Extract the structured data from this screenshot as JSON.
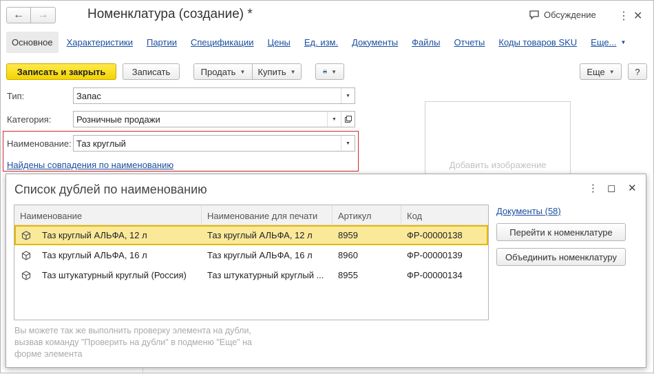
{
  "window": {
    "title": "Номенклатура (создание) *",
    "discussion": "Обсуждение"
  },
  "tabs": [
    "Основное",
    "Характеристики",
    "Партии",
    "Спецификации",
    "Цены",
    "Ед. изм.",
    "Документы",
    "Файлы",
    "Отчеты",
    "Коды товаров SKU",
    "Еще..."
  ],
  "toolbar": {
    "save_close": "Записать и закрыть",
    "save": "Записать",
    "sell": "Продать",
    "buy": "Купить",
    "more": "Еще",
    "help": "?"
  },
  "form": {
    "type_label": "Тип:",
    "type_value": "Запас",
    "category_label": "Категория:",
    "category_value": "Розничные продажи",
    "name_label": "Наименование:",
    "name_value": "Таз круглый",
    "matches_link": "Найдены совпадения по наименованию",
    "add_image": "Добавить изображение"
  },
  "popup": {
    "title": "Список дублей по наименованию",
    "columns": [
      "Наименование",
      "Наименование для печати",
      "Артикул",
      "Код"
    ],
    "rows": [
      {
        "name": "Таз круглый АЛЬФА, 12 л",
        "print_name": "Таз круглый АЛЬФА, 12 л",
        "article": "8959",
        "code": "ФР-00000138"
      },
      {
        "name": "Таз круглый АЛЬФА, 16 л",
        "print_name": "Таз круглый АЛЬФА, 16 л",
        "article": "8960",
        "code": "ФР-00000139"
      },
      {
        "name": "Таз штукатурный круглый (Россия)",
        "print_name": "Таз штукатурный круглый ...",
        "article": "8955",
        "code": "ФР-00000134"
      }
    ],
    "documents_link": "Документы (58)",
    "goto_button": "Перейти к номенклатуре",
    "merge_button": "Объединить номенклатуру",
    "hint": "Вы можете так же выполнить проверку элемента на дубли, вызвав команду \"Проверить на дубли\" в подменю \"Еще\" на форме элемента"
  },
  "colors": {
    "accent_yellow": "#f5d400",
    "selection": "#fbe99a",
    "link": "#1a4fa0",
    "highlight_border": "#d0262c"
  }
}
